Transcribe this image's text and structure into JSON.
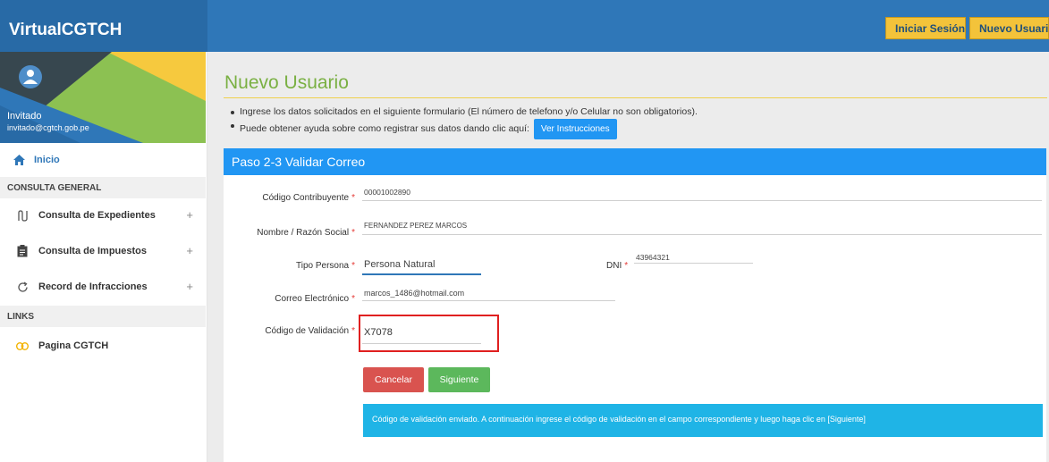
{
  "app": {
    "title": "VirtualCGTCH"
  },
  "header": {
    "login_label": "Iniciar Sesión",
    "new_user_label": "Nuevo Usuario"
  },
  "sidebar": {
    "user_name": "Invitado",
    "user_email": "invitado@cgtch.gob.pe",
    "home_label": "Inicio",
    "section_general": "CONSULTA GENERAL",
    "items": [
      {
        "label": "Consulta de Expedientes",
        "icon": "expedientes-icon",
        "expand": "+"
      },
      {
        "label": "Consulta de Impuestos",
        "icon": "clipboard-icon",
        "expand": "+"
      },
      {
        "label": "Record de Infracciones",
        "icon": "refresh-icon",
        "expand": "+"
      }
    ],
    "section_links": "LINKS",
    "link_label": "Pagina CGTCH"
  },
  "page": {
    "title": "Nuevo Usuario",
    "bullet1": "Ingrese los datos solicitados en el siguiente formulario (El número de telefono y/o Celular no son obligatorios).",
    "bullet2": "Puede obtener ayuda sobre como registrar sus datos dando clic aquí:",
    "instructions_button": "Ver Instrucciones"
  },
  "form": {
    "panel_title": "Paso 2-3 Validar Correo",
    "required_mark": "*",
    "codigo_label": "Código Contribuyente",
    "codigo_value": "00001002890",
    "nombre_label": "Nombre / Razón Social",
    "nombre_value": "FERNANDEZ PEREZ MARCOS",
    "tipo_label": "Tipo Persona",
    "tipo_value": "Persona Natural",
    "dni_label": "DNI",
    "dni_value": "43964321",
    "correo_label": "Correo Electrónico",
    "correo_value": "marcos_1486@hotmail.com",
    "validacion_label": "Código de Validación",
    "validacion_value": "X7078",
    "cancel_label": "Cancelar",
    "next_label": "Siguiente",
    "info_message": "Código de validación enviado. A continuación ingrese el código de validación en el campo correspondiente y luego haga clic en [Siguiente]"
  },
  "colors": {
    "brand_blue": "#2f77b8",
    "panel_blue": "#2196f3",
    "title_green": "#7ab043",
    "cancel_red": "#d9534f",
    "next_green": "#5cb85c",
    "info_cyan": "#1fb4e6",
    "highlight_red": "#e02020"
  }
}
